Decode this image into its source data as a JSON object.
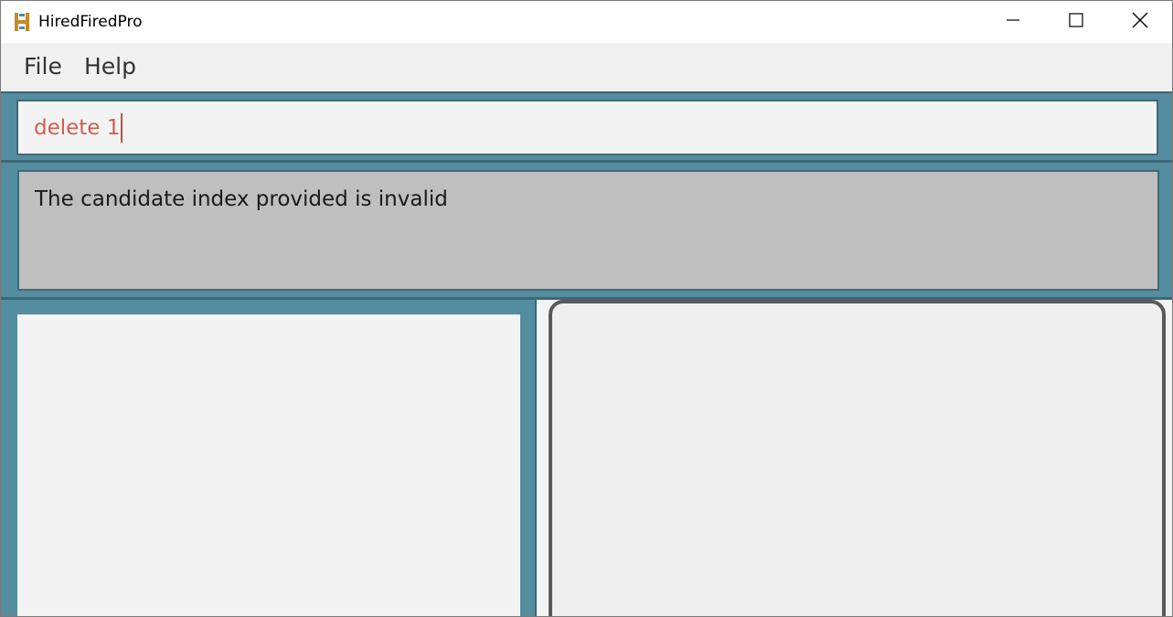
{
  "window": {
    "title": "HiredFiredPro"
  },
  "menu": {
    "items": [
      "File",
      "Help"
    ]
  },
  "command_box": {
    "value": "delete 1",
    "text_color": "#d25e4f"
  },
  "result_display": {
    "message": "The candidate index provided is invalid"
  },
  "theme": {
    "accent": "#538d9f",
    "border": "#3d6876"
  },
  "icons": {
    "app": "hiredfiredpro-logo-icon",
    "minimize": "minimize-icon",
    "maximize": "maximize-icon",
    "close": "close-icon"
  }
}
